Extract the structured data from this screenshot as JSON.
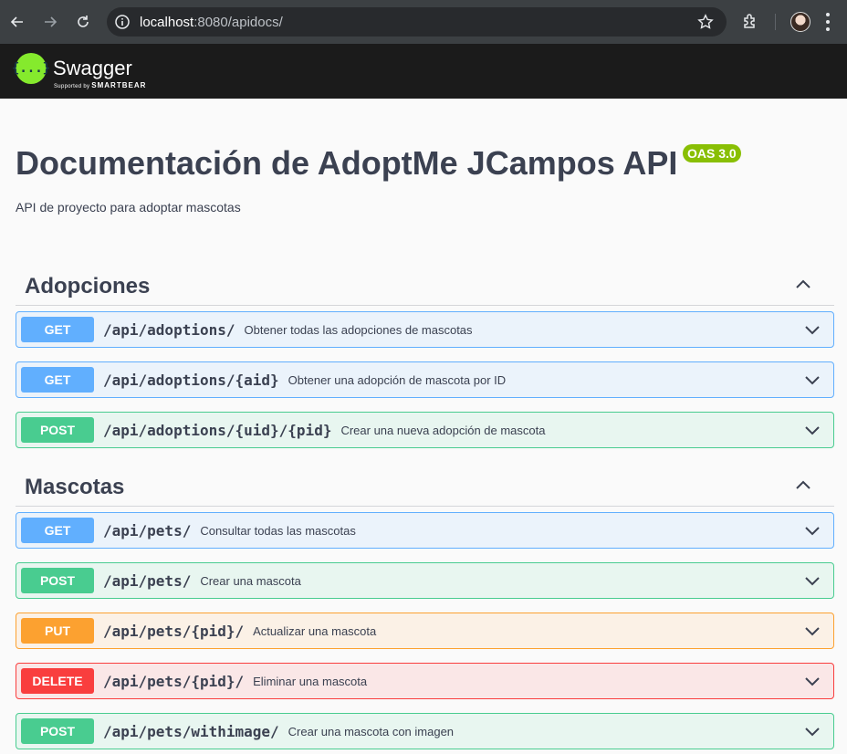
{
  "browser": {
    "url_host": "localhost",
    "url_rest": ":8080/apidocs/"
  },
  "topbar": {
    "brand": "Swagger",
    "supported_by": "Supported by",
    "company": "SMARTBEAR",
    "logo_glyph": "{...}"
  },
  "info": {
    "title": "Documentación de AdoptMe JCampos API",
    "version_badge": "OAS 3.0",
    "description": "API de proyecto para adoptar mascotas"
  },
  "sections": [
    {
      "name": "Adopciones",
      "operations": [
        {
          "method": "GET",
          "path": "/api/adoptions/",
          "summary": "Obtener todas las adopciones de mascotas"
        },
        {
          "method": "GET",
          "path": "/api/adoptions/{aid}",
          "summary": "Obtener una adopción de mascota por ID"
        },
        {
          "method": "POST",
          "path": "/api/adoptions/{uid}/{pid}",
          "summary": "Crear una nueva adopción de mascota"
        }
      ]
    },
    {
      "name": "Mascotas",
      "operations": [
        {
          "method": "GET",
          "path": "/api/pets/",
          "summary": "Consultar todas las mascotas"
        },
        {
          "method": "POST",
          "path": "/api/pets/",
          "summary": "Crear una mascota"
        },
        {
          "method": "PUT",
          "path": "/api/pets/{pid}/",
          "summary": "Actualizar una mascota"
        },
        {
          "method": "DELETE",
          "path": "/api/pets/{pid}/",
          "summary": "Eliminar una mascota"
        },
        {
          "method": "POST",
          "path": "/api/pets/withimage/",
          "summary": "Crear una mascota con imagen"
        }
      ]
    }
  ],
  "colors": {
    "get": "#61affe",
    "post": "#49cc90",
    "put": "#fca130",
    "delete": "#f93e3e",
    "oas_badge": "#89bf04",
    "swagger_green": "#85ea2d"
  }
}
